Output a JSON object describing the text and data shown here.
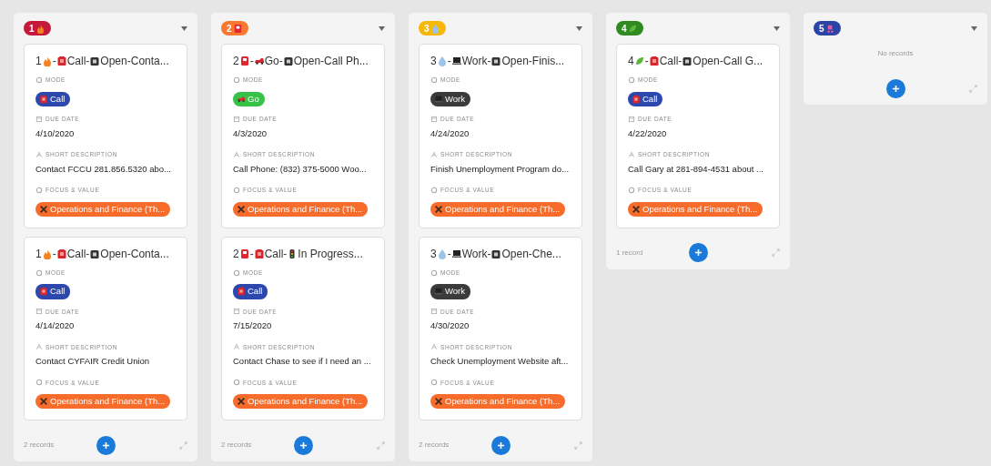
{
  "columns": [
    {
      "badge": {
        "number": "1",
        "color": "#c4193b"
      },
      "footer": "2 records",
      "cards": [
        {
          "title": [
            {
              "kind": "text",
              "text": "1"
            },
            {
              "kind": "fire"
            },
            {
              "kind": "text",
              "text": "-"
            },
            {
              "kind": "phone"
            },
            {
              "kind": "text",
              "text": "Call-"
            },
            {
              "kind": "square"
            },
            {
              "kind": "text",
              "text": "Open-Conta..."
            }
          ],
          "fields": [
            {
              "kind": "tag",
              "label": "MODE",
              "tag": {
                "kind": "phone",
                "text": "Call",
                "color": "#2c47ad"
              }
            },
            {
              "kind": "text",
              "label": "DUE DATE",
              "value": "4/10/2020"
            },
            {
              "kind": "text",
              "label": "SHORT DESCRIPTION",
              "value": "Contact FCCU 281.856.5320 abo..."
            },
            {
              "kind": "tag",
              "label": "FOCUS & VALUE",
              "tag": {
                "kind": "tools",
                "text": "Operations and Finance (Th...",
                "color": "#f76b2b"
              }
            }
          ]
        },
        {
          "title": [
            {
              "kind": "text",
              "text": "1"
            },
            {
              "kind": "fire"
            },
            {
              "kind": "text",
              "text": "-"
            },
            {
              "kind": "phone"
            },
            {
              "kind": "text",
              "text": "Call-"
            },
            {
              "kind": "square"
            },
            {
              "kind": "text",
              "text": "Open-Conta..."
            }
          ],
          "fields": [
            {
              "kind": "tag",
              "label": "MODE",
              "tag": {
                "kind": "phone",
                "text": "Call",
                "color": "#2c47ad"
              }
            },
            {
              "kind": "text",
              "label": "DUE DATE",
              "value": "4/14/2020"
            },
            {
              "kind": "text",
              "label": "SHORT DESCRIPTION",
              "value": "Contact CYFAIR Credit Union"
            },
            {
              "kind": "tag",
              "label": "FOCUS & VALUE",
              "tag": {
                "kind": "tools",
                "text": "Operations and Finance (Th...",
                "color": "#f76b2b"
              }
            }
          ]
        }
      ]
    },
    {
      "badge": {
        "number": "2",
        "color": "#f9782f"
      },
      "footer": "2 records",
      "cards": [
        {
          "title": [
            {
              "kind": "text",
              "text": "2"
            },
            {
              "kind": "card"
            },
            {
              "kind": "text",
              "text": "-"
            },
            {
              "kind": "car"
            },
            {
              "kind": "text",
              "text": "Go-"
            },
            {
              "kind": "square"
            },
            {
              "kind": "text",
              "text": "Open-Call Ph..."
            }
          ],
          "fields": [
            {
              "kind": "tag",
              "label": "MODE",
              "tag": {
                "kind": "car",
                "text": "Go",
                "color": "#36c247"
              }
            },
            {
              "kind": "text",
              "label": "DUE DATE",
              "value": "4/3/2020"
            },
            {
              "kind": "text",
              "label": "SHORT DESCRIPTION",
              "value": "Call Phone: (832) 375-5000 Woo..."
            },
            {
              "kind": "tag",
              "label": "FOCUS & VALUE",
              "tag": {
                "kind": "tools",
                "text": "Operations and Finance (Th...",
                "color": "#f76b2b"
              }
            }
          ]
        },
        {
          "title": [
            {
              "kind": "text",
              "text": "2"
            },
            {
              "kind": "card"
            },
            {
              "kind": "text",
              "text": "-"
            },
            {
              "kind": "phone"
            },
            {
              "kind": "text",
              "text": "Call-"
            },
            {
              "kind": "traffic"
            },
            {
              "kind": "text",
              "text": "In Progress..."
            }
          ],
          "fields": [
            {
              "kind": "tag",
              "label": "MODE",
              "tag": {
                "kind": "phone",
                "text": "Call",
                "color": "#2c47ad"
              }
            },
            {
              "kind": "text",
              "label": "DUE DATE",
              "value": "7/15/2020"
            },
            {
              "kind": "text",
              "label": "SHORT DESCRIPTION",
              "value": "Contact Chase to see if I need an ..."
            },
            {
              "kind": "tag",
              "label": "FOCUS & VALUE",
              "tag": {
                "kind": "tools",
                "text": "Operations and Finance (Th...",
                "color": "#f76b2b"
              }
            }
          ]
        }
      ]
    },
    {
      "badge": {
        "number": "3",
        "color": "#f6b90a"
      },
      "footer": "2 records",
      "cards": [
        {
          "title": [
            {
              "kind": "text",
              "text": "3"
            },
            {
              "kind": "drop"
            },
            {
              "kind": "text",
              "text": "-"
            },
            {
              "kind": "laptop"
            },
            {
              "kind": "text",
              "text": "Work-"
            },
            {
              "kind": "square"
            },
            {
              "kind": "text",
              "text": "Open-Finis..."
            }
          ],
          "fields": [
            {
              "kind": "tag",
              "label": "MODE",
              "tag": {
                "kind": "laptop",
                "text": "Work",
                "color": "#3b3b3b"
              }
            },
            {
              "kind": "text",
              "label": "DUE DATE",
              "value": "4/24/2020"
            },
            {
              "kind": "text",
              "label": "SHORT DESCRIPTION",
              "value": "Finish Unemployment Program do..."
            },
            {
              "kind": "tag",
              "label": "FOCUS & VALUE",
              "tag": {
                "kind": "tools",
                "text": "Operations and Finance (Th...",
                "color": "#f76b2b"
              }
            }
          ]
        },
        {
          "title": [
            {
              "kind": "text",
              "text": "3"
            },
            {
              "kind": "drop"
            },
            {
              "kind": "text",
              "text": "-"
            },
            {
              "kind": "laptop"
            },
            {
              "kind": "text",
              "text": "Work-"
            },
            {
              "kind": "square"
            },
            {
              "kind": "text",
              "text": "Open-Che..."
            }
          ],
          "fields": [
            {
              "kind": "tag",
              "label": "MODE",
              "tag": {
                "kind": "laptop",
                "text": "Work",
                "color": "#3b3b3b"
              }
            },
            {
              "kind": "text",
              "label": "DUE DATE",
              "value": "4/30/2020"
            },
            {
              "kind": "text",
              "label": "SHORT DESCRIPTION",
              "value": "Check Unemployment Website aft..."
            },
            {
              "kind": "tag",
              "label": "FOCUS & VALUE",
              "tag": {
                "kind": "tools",
                "text": "Operations and Finance (Th...",
                "color": "#f76b2b"
              }
            }
          ]
        }
      ]
    },
    {
      "badge": {
        "number": "4",
        "color": "#2f8a1f"
      },
      "footer": "1 record",
      "cards": [
        {
          "title": [
            {
              "kind": "text",
              "text": "4"
            },
            {
              "kind": "leaf"
            },
            {
              "kind": "text",
              "text": "-"
            },
            {
              "kind": "phone"
            },
            {
              "kind": "text",
              "text": "Call-"
            },
            {
              "kind": "square"
            },
            {
              "kind": "text",
              "text": "Open-Call G..."
            }
          ],
          "fields": [
            {
              "kind": "tag",
              "label": "MODE",
              "tag": {
                "kind": "phone",
                "text": "Call",
                "color": "#2c47ad"
              }
            },
            {
              "kind": "text",
              "label": "DUE DATE",
              "value": "4/22/2020"
            },
            {
              "kind": "text",
              "label": "SHORT DESCRIPTION",
              "value": "Call Gary at 281-894-4531 about ..."
            },
            {
              "kind": "tag",
              "label": "FOCUS & VALUE",
              "tag": {
                "kind": "tools",
                "text": "Operations and Finance (Th...",
                "color": "#f76b2b"
              }
            }
          ]
        }
      ]
    },
    {
      "badge": {
        "number": "5",
        "color": "#2b44a6"
      },
      "empty_text": "No records"
    }
  ]
}
